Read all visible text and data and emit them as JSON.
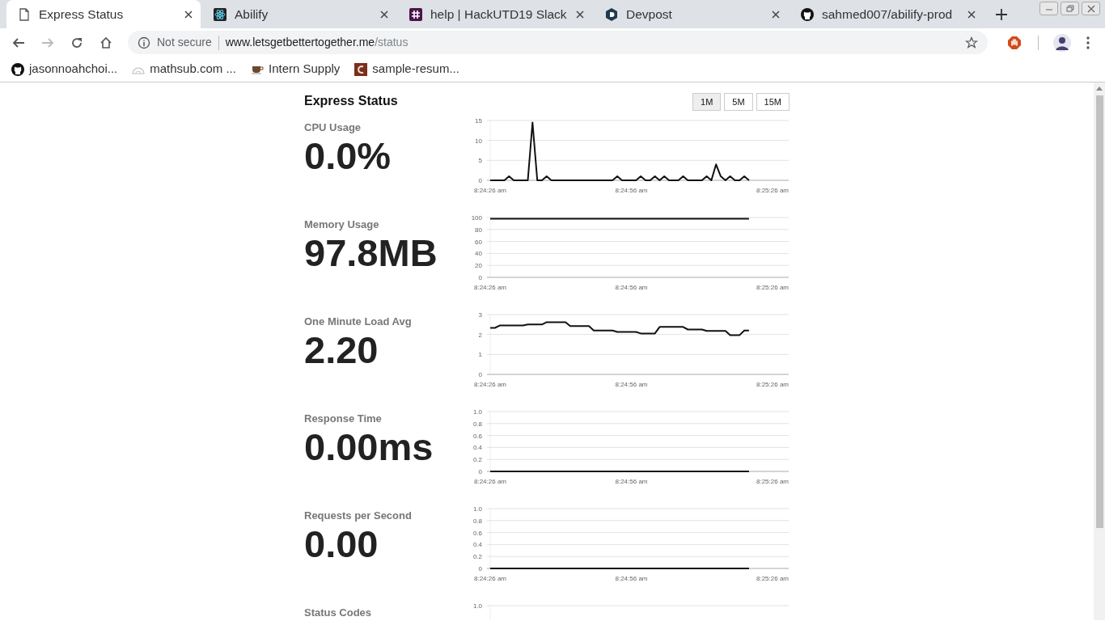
{
  "browser": {
    "tabs": [
      {
        "title": "Express Status",
        "selected": true
      },
      {
        "title": "Abilify",
        "selected": false
      },
      {
        "title": "help | HackUTD19 Slack",
        "selected": false
      },
      {
        "title": "Devpost",
        "selected": false
      },
      {
        "title": "sahmed007/abilify-prod",
        "selected": false
      }
    ],
    "address_bar": {
      "security": "Not secure",
      "host": "www.letsgetbettertogether.me",
      "path": "/status"
    },
    "bookmarks": [
      "jasonnoahchoi...",
      "mathsub.com ...",
      "Intern Supply",
      "sample-resum..."
    ]
  },
  "page": {
    "title": "Express Status",
    "intervals": [
      {
        "label": "1M",
        "selected": true
      },
      {
        "label": "5M",
        "selected": false
      },
      {
        "label": "15M",
        "selected": false
      }
    ],
    "metrics": [
      {
        "label": "CPU Usage",
        "value": "0.0%",
        "chart_data": {
          "type": "line",
          "grid": true,
          "ylim": [
            0,
            15
          ],
          "yticks": [
            0,
            5,
            10,
            15
          ],
          "categories": [
            "8:24:26 am",
            null,
            null,
            null,
            null,
            null,
            null,
            null,
            null,
            null,
            null,
            null,
            null,
            null,
            null,
            null,
            null,
            null,
            null,
            null,
            null,
            null,
            null,
            null,
            null,
            null,
            null,
            null,
            null,
            null,
            "8:24:56 am",
            null,
            null,
            null,
            null,
            null,
            null,
            null,
            null,
            null,
            null,
            null,
            null,
            null,
            null,
            null,
            null,
            null,
            null,
            null,
            null,
            null,
            null,
            null,
            null,
            null,
            null,
            null,
            null,
            null,
            "8:25:26 am"
          ],
          "series": [
            {
              "color": "#111111",
              "values": [
                0,
                0,
                0,
                0,
                1,
                0,
                0,
                0,
                0,
                14.5,
                0,
                0,
                1,
                0,
                0,
                0,
                0,
                0,
                0,
                0,
                0,
                0,
                0,
                0,
                0,
                0,
                0,
                1,
                0,
                0,
                0,
                0,
                1,
                0,
                0,
                1,
                0,
                1,
                0,
                0,
                0,
                1,
                0,
                0,
                0,
                0,
                1,
                0,
                4,
                1,
                0,
                1,
                0,
                0,
                1,
                0,
                null,
                null,
                null,
                null,
                null
              ]
            }
          ]
        }
      },
      {
        "label": "Memory Usage",
        "value": "97.8MB",
        "chart_data": {
          "type": "line",
          "grid": true,
          "ylim": [
            0,
            100
          ],
          "yticks": [
            0,
            20,
            40,
            60,
            80,
            100
          ],
          "categories": [
            "8:24:26 am",
            null,
            null,
            null,
            null,
            null,
            null,
            null,
            null,
            null,
            null,
            null,
            null,
            null,
            null,
            null,
            null,
            null,
            null,
            null,
            null,
            null,
            null,
            null,
            null,
            null,
            null,
            null,
            null,
            null,
            "8:24:56 am",
            null,
            null,
            null,
            null,
            null,
            null,
            null,
            null,
            null,
            null,
            null,
            null,
            null,
            null,
            null,
            null,
            null,
            null,
            null,
            null,
            null,
            null,
            null,
            null,
            null,
            null,
            null,
            null,
            null,
            "8:25:26 am"
          ],
          "series": [
            {
              "color": "#111111",
              "values": [
                98,
                98,
                98,
                98,
                98,
                98,
                98,
                98,
                98,
                98,
                98,
                98,
                98,
                98,
                98,
                98,
                98,
                98,
                98,
                98,
                98,
                98,
                98,
                98,
                98,
                98,
                98,
                98,
                98,
                98,
                98,
                98,
                98,
                98,
                98,
                98,
                98,
                98,
                98,
                98,
                98,
                98,
                98,
                98,
                98,
                98,
                98,
                98,
                98,
                98,
                98,
                98,
                98,
                98,
                98,
                98,
                null,
                null,
                null,
                null,
                null
              ]
            }
          ]
        }
      },
      {
        "label": "One Minute Load Avg",
        "value": "2.20",
        "chart_data": {
          "type": "line",
          "grid": true,
          "ylim": [
            0,
            3
          ],
          "yticks": [
            0,
            1,
            2,
            3
          ],
          "categories": [
            "8:24:26 am",
            null,
            null,
            null,
            null,
            null,
            null,
            null,
            null,
            null,
            null,
            null,
            null,
            null,
            null,
            null,
            null,
            null,
            null,
            null,
            null,
            null,
            null,
            null,
            null,
            null,
            null,
            null,
            null,
            null,
            "8:24:56 am",
            null,
            null,
            null,
            null,
            null,
            null,
            null,
            null,
            null,
            null,
            null,
            null,
            null,
            null,
            null,
            null,
            null,
            null,
            null,
            null,
            null,
            null,
            null,
            null,
            null,
            null,
            null,
            null,
            null,
            "8:25:26 am"
          ],
          "series": [
            {
              "color": "#111111",
              "values": [
                2.33,
                2.33,
                2.45,
                2.45,
                2.45,
                2.45,
                2.45,
                2.45,
                2.5,
                2.5,
                2.5,
                2.5,
                2.62,
                2.62,
                2.62,
                2.62,
                2.62,
                2.42,
                2.42,
                2.42,
                2.42,
                2.42,
                2.2,
                2.2,
                2.2,
                2.2,
                2.2,
                2.13,
                2.13,
                2.13,
                2.13,
                2.13,
                2.05,
                2.05,
                2.05,
                2.05,
                2.38,
                2.38,
                2.38,
                2.38,
                2.38,
                2.38,
                2.25,
                2.25,
                2.25,
                2.25,
                2.18,
                2.18,
                2.18,
                2.18,
                2.18,
                1.97,
                1.97,
                1.97,
                2.2,
                2.2,
                null,
                null,
                null,
                null,
                null
              ]
            }
          ]
        }
      },
      {
        "label": "Response Time",
        "value": "0.00ms",
        "chart_data": {
          "type": "line",
          "grid": true,
          "ylim": [
            0,
            1
          ],
          "yticks": [
            0,
            {
              "value": 0.2,
              "label": "0.2"
            },
            {
              "value": 0.4,
              "label": "0.4"
            },
            {
              "value": 0.6,
              "label": "0.6"
            },
            {
              "value": 0.8,
              "label": "0.8"
            },
            {
              "value": 1,
              "label": "1.0"
            }
          ],
          "categories": [
            "8:24:26 am",
            null,
            null,
            null,
            null,
            null,
            null,
            null,
            null,
            null,
            null,
            null,
            null,
            null,
            null,
            null,
            null,
            null,
            null,
            null,
            null,
            null,
            null,
            null,
            null,
            null,
            null,
            null,
            null,
            null,
            "8:24:56 am",
            null,
            null,
            null,
            null,
            null,
            null,
            null,
            null,
            null,
            null,
            null,
            null,
            null,
            null,
            null,
            null,
            null,
            null,
            null,
            null,
            null,
            null,
            null,
            null,
            null,
            null,
            null,
            null,
            null,
            "8:25:26 am"
          ],
          "series": [
            {
              "color": "#111111",
              "values": [
                0,
                0,
                0,
                0,
                0,
                0,
                0,
                0,
                0,
                0,
                0,
                0,
                0,
                0,
                0,
                0,
                0,
                0,
                0,
                0,
                0,
                0,
                0,
                0,
                0,
                0,
                0,
                0,
                0,
                0,
                0,
                0,
                0,
                0,
                0,
                0,
                0,
                0,
                0,
                0,
                0,
                0,
                0,
                0,
                0,
                0,
                0,
                0,
                0,
                0,
                0,
                0,
                0,
                0,
                0,
                0,
                null,
                null,
                null,
                null,
                null
              ]
            }
          ]
        }
      },
      {
        "label": "Requests per Second",
        "value": "0.00",
        "chart_data": {
          "type": "line",
          "grid": true,
          "ylim": [
            0,
            1
          ],
          "yticks": [
            0,
            {
              "value": 0.2,
              "label": "0.2"
            },
            {
              "value": 0.4,
              "label": "0.4"
            },
            {
              "value": 0.6,
              "label": "0.6"
            },
            {
              "value": 0.8,
              "label": "0.8"
            },
            {
              "value": 1,
              "label": "1.0"
            }
          ],
          "categories": [
            "8:24:26 am",
            null,
            null,
            null,
            null,
            null,
            null,
            null,
            null,
            null,
            null,
            null,
            null,
            null,
            null,
            null,
            null,
            null,
            null,
            null,
            null,
            null,
            null,
            null,
            null,
            null,
            null,
            null,
            null,
            null,
            "8:24:56 am",
            null,
            null,
            null,
            null,
            null,
            null,
            null,
            null,
            null,
            null,
            null,
            null,
            null,
            null,
            null,
            null,
            null,
            null,
            null,
            null,
            null,
            null,
            null,
            null,
            null,
            null,
            null,
            null,
            null,
            "8:25:26 am"
          ],
          "series": [
            {
              "color": "#111111",
              "values": [
                0,
                0,
                0,
                0,
                0,
                0,
                0,
                0,
                0,
                0,
                0,
                0,
                0,
                0,
                0,
                0,
                0,
                0,
                0,
                0,
                0,
                0,
                0,
                0,
                0,
                0,
                0,
                0,
                0,
                0,
                0,
                0,
                0,
                0,
                0,
                0,
                0,
                0,
                0,
                0,
                0,
                0,
                0,
                0,
                0,
                0,
                0,
                0,
                0,
                0,
                0,
                0,
                0,
                0,
                0,
                0,
                null,
                null,
                null,
                null,
                null
              ]
            }
          ]
        }
      },
      {
        "label": "Status Codes",
        "chart_data": {
          "type": "other",
          "annotations": [
            {
              "text": "1.0"
            }
          ]
        }
      }
    ]
  }
}
